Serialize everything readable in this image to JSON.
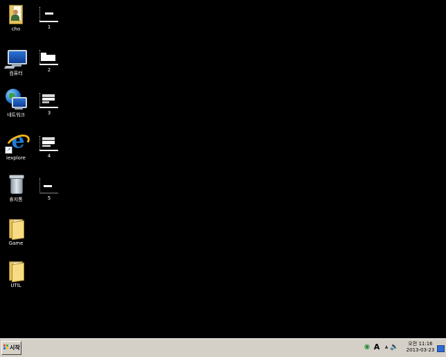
{
  "desktop": {
    "icons": [
      {
        "label": "cho",
        "icon": "user-folder-icon"
      },
      {
        "label": "컴퓨터",
        "icon": "computer-icon"
      },
      {
        "label": "네트워크",
        "icon": "network-icon"
      },
      {
        "label": "iexplore",
        "icon": "internet-explorer-icon"
      },
      {
        "label": "휴지통",
        "icon": "recycle-bin-icon"
      },
      {
        "label": "Game",
        "icon": "folder-icon"
      },
      {
        "label": "UTIL",
        "icon": "folder-icon"
      }
    ],
    "layout_shortcuts": [
      {
        "label": "1",
        "icon": "layout-thumbnail-icon"
      },
      {
        "label": "2",
        "icon": "layout-thumbnail-icon"
      },
      {
        "label": "3",
        "icon": "layout-thumbnail-icon"
      },
      {
        "label": "4",
        "icon": "layout-thumbnail-icon"
      },
      {
        "label": "5",
        "icon": "layout-thumbnail-icon"
      }
    ]
  },
  "taskbar": {
    "start_label": "시작",
    "tray": {
      "ime_label": "A",
      "clock_time": "오전 11:16",
      "clock_date": "2013-03-23"
    }
  },
  "colors": {
    "desktop_background": "#000000",
    "taskbar_background": "#d4d0c8"
  }
}
